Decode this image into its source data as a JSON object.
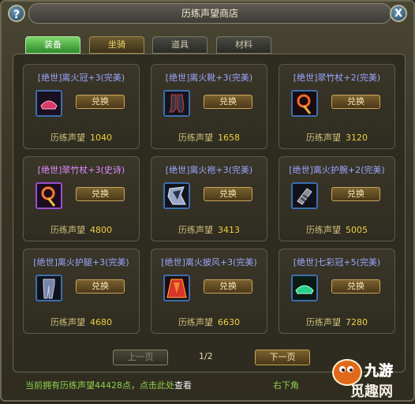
{
  "window": {
    "title": "历练声望商店",
    "help": "?",
    "close": "X"
  },
  "tabs": [
    {
      "label": "装备"
    },
    {
      "label": "坐骑"
    },
    {
      "label": "道具"
    },
    {
      "label": "材料"
    }
  ],
  "items": [
    {
      "name": "[绝世]离火冠+3(完美)",
      "buy": "兑换",
      "currency": "历练声望",
      "price": "1040"
    },
    {
      "name": "[绝世]离火靴+3(完美)",
      "buy": "兑换",
      "currency": "历练声望",
      "price": "1658"
    },
    {
      "name": "[绝世]翠竹杖+2(完美)",
      "buy": "兑换",
      "currency": "历练声望",
      "price": "3120"
    },
    {
      "name": "[绝世]翠竹杖+3(史诗)",
      "buy": "兑换",
      "currency": "历练声望",
      "price": "4800"
    },
    {
      "name": "[绝世]离火袍+3(完美)",
      "buy": "兑换",
      "currency": "历练声望",
      "price": "3413"
    },
    {
      "name": "[绝世]离火护腕+2(完美)",
      "buy": "兑换",
      "currency": "历练声望",
      "price": "5005"
    },
    {
      "name": "[绝世]离火护腿+3(完美)",
      "buy": "兑换",
      "currency": "历练声望",
      "price": "4680"
    },
    {
      "name": "[绝世]离火披风+3(完美)",
      "buy": "兑换",
      "currency": "历练声望",
      "price": "6630"
    },
    {
      "name": "[绝世]七彩冠+5(完美)",
      "buy": "兑换",
      "currency": "历练声望",
      "price": "7280"
    }
  ],
  "pager": {
    "prev": "上一页",
    "next": "下一页",
    "page": "1/2"
  },
  "status": {
    "text": "当前拥有历练声望44428点，点击此处",
    "link": "查看"
  },
  "hint": "右下角",
  "watermark": "九游 觅趣网"
}
